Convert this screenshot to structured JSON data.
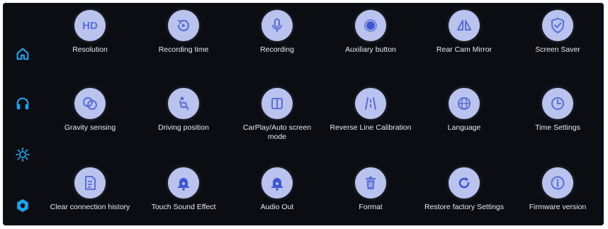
{
  "colors": {
    "background": "#0b0d12",
    "icon_circle": "#b9c3ee",
    "icon_glyph": "#5a6fd6",
    "sidebar_accent": "#1aa3e8",
    "label_text": "#e9ecf5"
  },
  "sidebar": {
    "items": [
      {
        "name": "home",
        "icon": "home-icon"
      },
      {
        "name": "headphones",
        "icon": "headphones-icon"
      },
      {
        "name": "brightness",
        "icon": "brightness-icon"
      },
      {
        "name": "settings",
        "icon": "settings-hex-icon"
      }
    ]
  },
  "tiles": {
    "resolution": {
      "label": "Resolution",
      "icon": "hd-icon"
    },
    "recording_time": {
      "label": "Recording time",
      "icon": "recording-time-icon"
    },
    "recording": {
      "label": "Recording",
      "icon": "microphone-icon"
    },
    "auxiliary_button": {
      "label": "Auxiliary button",
      "icon": "auxiliary-dot-icon"
    },
    "rear_cam_mirror": {
      "label": "Rear Cam Mirror",
      "icon": "mirror-icon"
    },
    "screen_saver": {
      "label": "Screen Saver",
      "icon": "shield-icon"
    },
    "gravity_sensing": {
      "label": "Gravity sensing",
      "icon": "gravity-icon"
    },
    "driving_position": {
      "label": "Driving position",
      "icon": "seat-icon"
    },
    "carplay_mode": {
      "label": "CarPlay/Auto screen mode",
      "icon": "split-screen-icon"
    },
    "reverse_line": {
      "label": "Reverse Line Calibration",
      "icon": "reverse-lines-icon"
    },
    "language": {
      "label": "Language",
      "icon": "globe-icon"
    },
    "time_settings": {
      "label": "Time Settings",
      "icon": "clock-icon"
    },
    "clear_history": {
      "label": "Clear connection history",
      "icon": "clear-history-icon"
    },
    "touch_sound": {
      "label": "Touch Sound Effect",
      "icon": "bell-icon"
    },
    "audio_out": {
      "label": "Audio Out",
      "icon": "speaker-bell-icon"
    },
    "format": {
      "label": "Format",
      "icon": "trash-icon"
    },
    "restore": {
      "label": "Restore factory Settings",
      "icon": "refresh-icon"
    },
    "firmware": {
      "label": "Firmware version",
      "icon": "info-icon"
    }
  }
}
